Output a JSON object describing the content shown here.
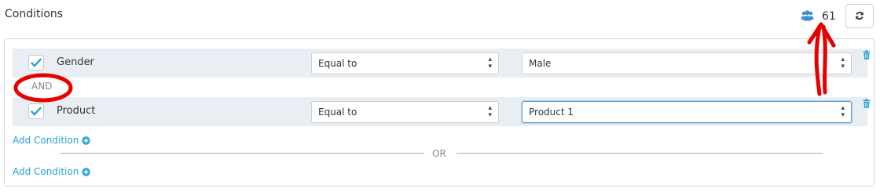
{
  "header": {
    "title": "Conditions",
    "audience_count": "61",
    "users_icon": "users-icon",
    "refresh_icon": "refresh-icon"
  },
  "conditions": [
    {
      "label": "Gender",
      "checked": true,
      "operator": "Equal to",
      "value": "Male"
    },
    {
      "label": "Product",
      "checked": true,
      "operator": "Equal to",
      "value": "Product 1"
    }
  ],
  "joiner": "AND",
  "add_condition_label": "Add Condition",
  "or_label": "OR",
  "colors": {
    "accent": "#2a9fd6",
    "row_bg": "#e8eef3",
    "annotation": "#e60000"
  }
}
